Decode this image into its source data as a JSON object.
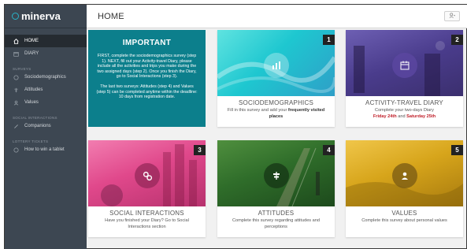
{
  "app": {
    "brand": "minerva",
    "page_title": "HOME",
    "user_menu_icon": "user-icon"
  },
  "sidebar": {
    "items": [
      {
        "label": "HOME",
        "icon": "home-icon"
      },
      {
        "label": "DIARY",
        "icon": "calendar-icon"
      }
    ],
    "section_surveys": "SURVEYS",
    "survey_items": [
      {
        "label": "Sociodemographics",
        "icon": "sociodemographics-icon"
      },
      {
        "label": "Attitudes",
        "icon": "attitudes-icon"
      },
      {
        "label": "Values",
        "icon": "values-icon"
      }
    ],
    "section_social": "SOCIAL INTERACTIONS",
    "social_items": [
      {
        "label": "Companions",
        "icon": "link-icon"
      }
    ],
    "section_lottery": "LOTTERY TICKETS",
    "lottery_items": [
      {
        "label": "How to win a tablet",
        "icon": "ticket-icon"
      }
    ]
  },
  "important": {
    "title": "IMPORTANT",
    "text1": "FIRST, complete the sociodemographics survey (step 1). NEXT, fill out your Activity-travel Diary, please include all the activities and trips you make during the two assigned days (step 2). Once you finish the Diary, go to Social Interactions (step 3).",
    "text2": "The last two surveys: Attitudes (step 4) and Values (step 5) can be completed anytime within the deadline: 10 days from registration date."
  },
  "cards": {
    "socio": {
      "step": "1",
      "title": "SOCIODEMOGRAPHICS",
      "desc_pre": "Fill in this survey and add your ",
      "desc_bold": "frequently visited places",
      "icon": "chart-icon",
      "color": "#19c2c9"
    },
    "diary": {
      "step": "2",
      "title": "ACTIVITY-TRAVEL DIARY",
      "desc_pre": "Complete your two-days Diary",
      "day1": "Friday 24th",
      "and": " and ",
      "day2": "Saturday 25th",
      "icon": "calendar-icon",
      "color": "#5b4a9c"
    },
    "social": {
      "step": "3",
      "title": "SOCIAL INTERACTIONS",
      "desc": "Have you finished your Diary? Go to Social Interactions section",
      "icon": "link-icon",
      "color": "#e0488b"
    },
    "attitudes": {
      "step": "4",
      "title": "ATTITUDES",
      "desc": "Complete this survey regarding attitudes and perceptions",
      "icon": "signpost-icon",
      "color": "#2f6d2a"
    },
    "values": {
      "step": "5",
      "title": "VALUES",
      "desc": "Complete this survey about personal values",
      "icon": "person-icon",
      "color": "#d7a51b"
    }
  }
}
